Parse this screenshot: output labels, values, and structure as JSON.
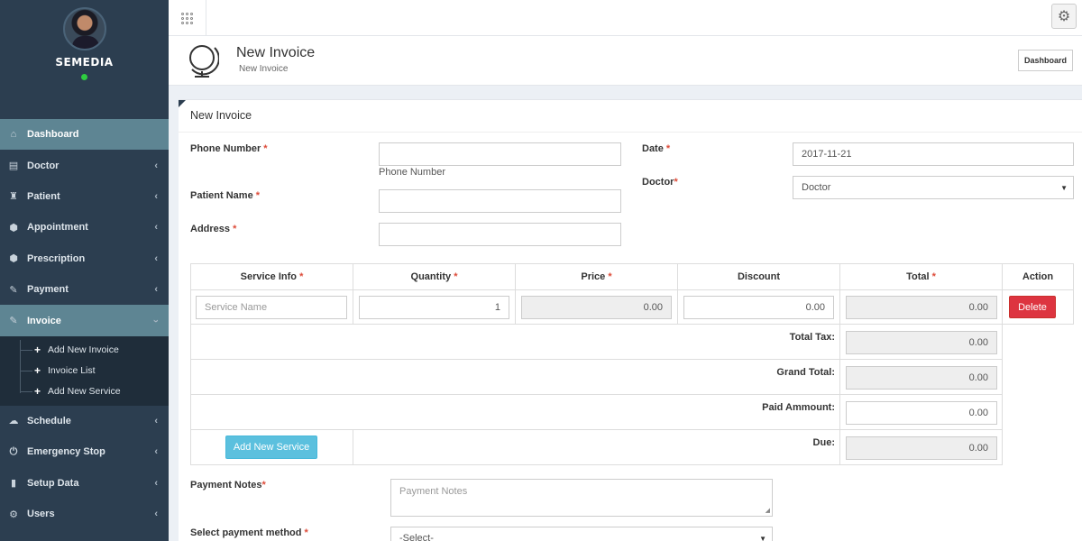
{
  "sidebar": {
    "user_name": "SEMEDIA",
    "menu": [
      {
        "label": "Dashboard",
        "icon": "home-icon",
        "glyph": "⌂"
      },
      {
        "label": "Doctor",
        "icon": "document-icon",
        "glyph": "▤"
      },
      {
        "label": "Patient",
        "icon": "patient-icon",
        "glyph": "♜"
      },
      {
        "label": "Appointment",
        "icon": "appointment-icon",
        "glyph": "⬢"
      },
      {
        "label": "Prescription",
        "icon": "prescription-icon",
        "glyph": "⬢"
      },
      {
        "label": "Payment",
        "icon": "payment-icon",
        "glyph": "✎"
      },
      {
        "label": "Invoice",
        "icon": "invoice-icon",
        "glyph": "✎"
      }
    ],
    "invoice_sub": [
      {
        "label": "Add New Invoice"
      },
      {
        "label": "Invoice List"
      },
      {
        "label": "Add New Service"
      }
    ],
    "menu_after": [
      {
        "label": "Schedule",
        "icon": "schedule-icon",
        "glyph": "☁"
      },
      {
        "label": "Emergency Stop",
        "icon": "power-icon",
        "glyph": "⏻"
      },
      {
        "label": "Setup Data",
        "icon": "bar-chart-icon",
        "glyph": "▮"
      },
      {
        "label": "Users",
        "icon": "users-icon",
        "glyph": "⚙"
      }
    ]
  },
  "header": {
    "title": "New Invoice",
    "subtitle": "New Invoice",
    "dashboard_button": "Dashboard"
  },
  "form": {
    "panel_title": "New Invoice",
    "phone_label": "Phone Number",
    "phone_value": "",
    "phone_help": "Phone Number",
    "patient_label": "Patient Name",
    "patient_value": "",
    "address_label": "Address",
    "address_value": "",
    "date_label": "Date",
    "date_value": "2017-11-21",
    "doctor_label": "Doctor",
    "doctor_value": "Doctor",
    "required_mark": "*",
    "payment_notes_label": "Payment Notes",
    "payment_notes_placeholder": "Payment Notes",
    "payment_method_label": "Select payment method",
    "payment_method_value": "-Select-"
  },
  "service_table": {
    "headers": {
      "service": "Service Info",
      "quantity": "Quantity",
      "price": "Price",
      "discount": "Discount",
      "total": "Total",
      "action": "Action"
    },
    "row": {
      "service_placeholder": "Service Name",
      "quantity": "1",
      "price": "0.00",
      "discount": "0.00",
      "total": "0.00",
      "delete_label": "Delete"
    },
    "summary": {
      "total_tax_label": "Total Tax:",
      "total_tax": "0.00",
      "grand_total_label": "Grand Total:",
      "grand_total": "0.00",
      "paid_label": "Paid Ammount:",
      "paid": "0.00",
      "due_label": "Due:",
      "due": "0.00"
    },
    "add_service_button": "Add New Service"
  },
  "colors": {
    "sidebar_bg": "#2c3e50",
    "active_item_bg": "#5e8593",
    "delete_button": "#dd3440",
    "add_button": "#5bc0de",
    "required": "#dd4b39"
  }
}
